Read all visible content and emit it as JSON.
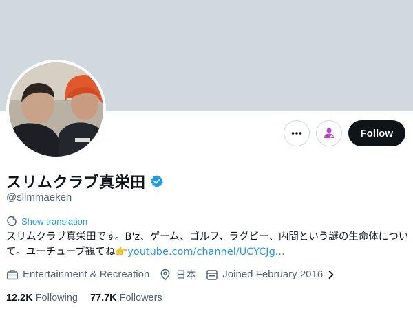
{
  "profile": {
    "display_name": "スリムクラブ真栄田",
    "handle": "@slimmaeken",
    "verified": true,
    "show_translation": "Show translation",
    "bio_text": "スリムクラブ真栄田です。B'z、ゲーム、ゴルフ、ラグビー、内間という謎の生命体について。ユーチューブ観てね👉",
    "bio_link": "youtube.com/channel/UCYCJg...",
    "category": "Entertainment & Recreation",
    "location": "日本",
    "joined": "Joined February 2016",
    "following_count": "12.2K",
    "following_label": "Following",
    "followers_count": "77.7K",
    "followers_label": "Followers"
  },
  "actions": {
    "more_icon": "more-icon",
    "subscribe_icon": "subscribe-icon",
    "follow_label": "Follow"
  },
  "colors": {
    "banner": "#cfd9de",
    "accent": "#1d9bf0",
    "follow_bg": "#0f1419",
    "subscribe_accent": "#c340d6",
    "secondary_text": "#536471"
  }
}
